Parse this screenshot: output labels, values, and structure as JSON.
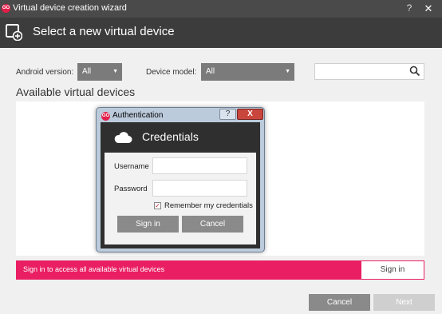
{
  "window": {
    "title": "Virtual device creation wizard",
    "logo_text": "GO",
    "help_glyph": "?",
    "close_glyph": "✕"
  },
  "header": {
    "title": "Select a new virtual device"
  },
  "filters": {
    "android_version_label": "Android version:",
    "android_version_value": "All",
    "device_model_label": "Device model:",
    "device_model_value": "All",
    "search_value": ""
  },
  "list": {
    "title": "Available virtual devices"
  },
  "signin_bar": {
    "message": "Sign in to access all available virtual devices",
    "button_label": "Sign in"
  },
  "footer": {
    "cancel_label": "Cancel",
    "next_label": "Next"
  },
  "dialog": {
    "title": "Authentication",
    "logo_text": "GO",
    "help_glyph": "?",
    "close_glyph": "X",
    "heading": "Credentials",
    "username_label": "Username",
    "username_value": "",
    "password_label": "Password",
    "password_value": "",
    "remember_label": "Remember my credentials",
    "remember_checked": true,
    "signin_label": "Sign in",
    "cancel_label": "Cancel"
  },
  "colors": {
    "accent": "#e91e63",
    "header_bg": "#3c3c3c",
    "titlebar_bg": "#4a4a4a",
    "dropdown_bg": "#7b7b7b",
    "button_gray": "#8a8a8a"
  },
  "icons": {
    "app_logo": "genymotion-logo-icon",
    "new_device": "add-device-icon",
    "search": "magnifier-icon",
    "cloud": "cloud-icon",
    "dropdown": "triangle-down-icon"
  }
}
